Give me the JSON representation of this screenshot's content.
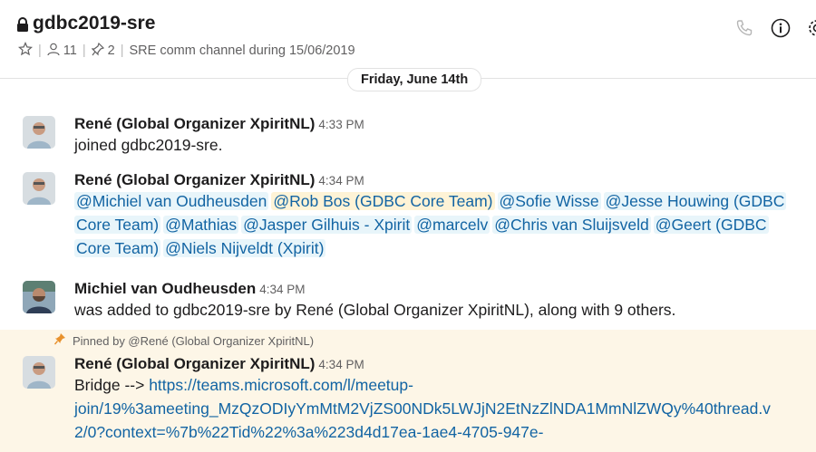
{
  "channel": {
    "name": "gdbc2019-sre",
    "members": "11",
    "pins": "2",
    "topic": "SRE comm channel during 15/06/2019"
  },
  "day_divider": "Friday, June 14th",
  "messages": [
    {
      "author": "René (Global Organizer XpiritNL)",
      "time": "4:33 PM",
      "text": "joined gdbc2019-sre."
    },
    {
      "author": "René (Global Organizer XpiritNL)",
      "time": "4:34 PM",
      "mentions": [
        "@Michiel van Oudheusden",
        "@Rob Bos (GDBC Core Team)",
        "@Sofie Wisse",
        "@Jesse Houwing (GDBC",
        "Core Team)",
        "@Mathias",
        "@Jasper Gilhuis - Xpirit",
        "@marcelv",
        "@Chris van Sluijsveld",
        "@Geert (GDBC",
        "Core Team)",
        "@Niels Nijveldt (Xpirit)"
      ]
    },
    {
      "author": "Michiel van Oudheusden",
      "time": "4:34 PM",
      "text": "was added to gdbc2019-sre by René (Global Organizer XpiritNL), along with 9 others."
    },
    {
      "pinned_by": "Pinned by @René (Global Organizer XpiritNL)",
      "author": "René (Global Organizer XpiritNL)",
      "time": "4:34 PM",
      "text_prefix": "Bridge -->",
      "link_line1": "https://teams.microsoft.com/l/meetup-",
      "link_line2": "join/19%3ameeting_MzQzODIyYmMtM2VjZS00NDk5LWJjN2EtNzZlNDA1MmNlZWQy%40thread.v",
      "link_line3": "2/0?context=%7b%22Tid%22%3a%223d4d17ea-1ae4-4705-947e-"
    }
  ],
  "colors": {
    "link": "#1264a3",
    "mention_bg": "#e8f5fa",
    "mention_highlight_bg": "#fef3d6",
    "pinned_bg": "#fdf6e7",
    "pin_icon": "#e8912d"
  }
}
